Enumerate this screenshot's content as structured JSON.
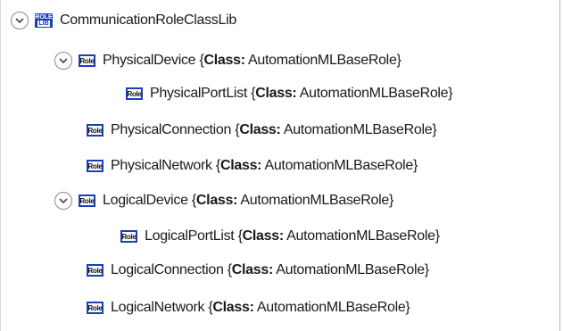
{
  "tree": {
    "root": {
      "name": "CommunicationRoleClassLib",
      "icon": "role-class-library-icon",
      "icon_text_top": "ROLE",
      "icon_text_bottom": "LIB",
      "expanded": true
    },
    "items": [
      {
        "name": "PhysicalDevice",
        "prefix": " {",
        "class_keyword": "Class:",
        "class_value": " AutomationMLBaseRole}",
        "icon_text": "Role",
        "expanded": true
      },
      {
        "name": "PhysicalPortList",
        "prefix": " {",
        "class_keyword": "Class:",
        "class_value": " AutomationMLBaseRole}",
        "icon_text": "Role"
      },
      {
        "name": "PhysicalConnection",
        "prefix": " {",
        "class_keyword": "Class:",
        "class_value": " AutomationMLBaseRole}",
        "icon_text": "Role"
      },
      {
        "name": "PhysicalNetwork",
        "prefix": " {",
        "class_keyword": "Class:",
        "class_value": " AutomationMLBaseRole}",
        "icon_text": "Role"
      },
      {
        "name": "LogicalDevice",
        "prefix": " {",
        "class_keyword": "Class:",
        "class_value": " AutomationMLBaseRole}",
        "icon_text": "Role",
        "expanded": true
      },
      {
        "name": "LogicalPortList",
        "prefix": " {",
        "class_keyword": "Class:",
        "class_value": " AutomationMLBaseRole}",
        "icon_text": "Role"
      },
      {
        "name": "LogicalConnection",
        "prefix": " {",
        "class_keyword": "Class:",
        "class_value": " AutomationMLBaseRole}",
        "icon_text": "Role"
      },
      {
        "name": "LogicalNetwork",
        "prefix": " {",
        "class_keyword": "Class:",
        "class_value": " AutomationMLBaseRole}",
        "icon_text": "Role"
      }
    ]
  },
  "colors": {
    "icon_border": "#1a3fb8",
    "text": "#1a1a1a",
    "toggle_border": "#8a8a8a"
  }
}
